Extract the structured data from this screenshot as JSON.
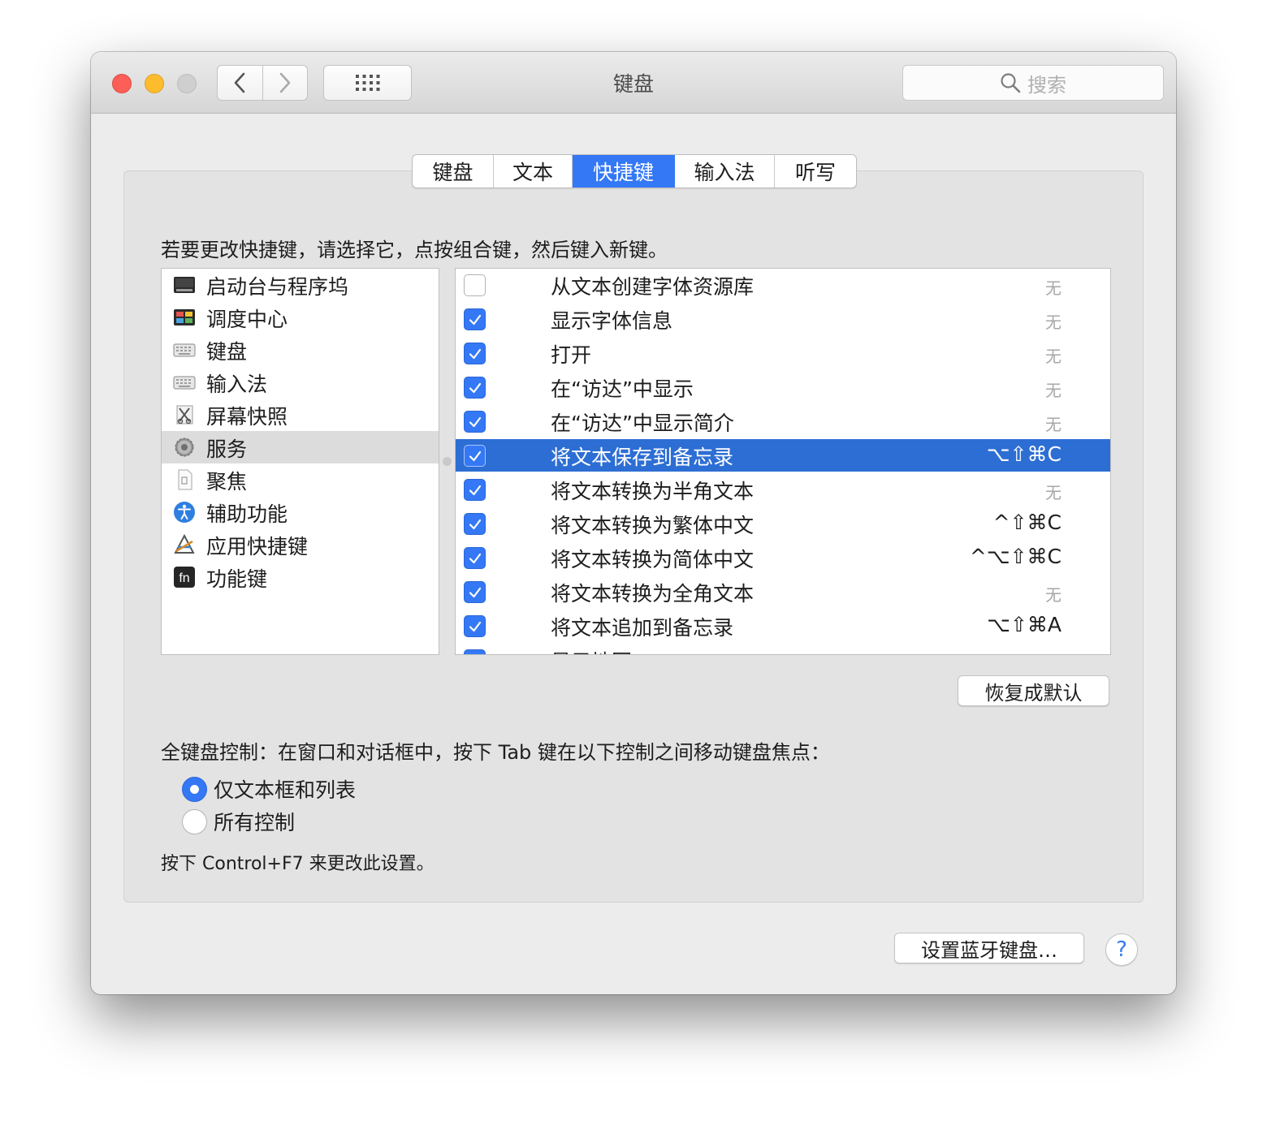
{
  "window": {
    "title": "键盘"
  },
  "search": {
    "placeholder": "搜索"
  },
  "tabs": [
    {
      "label": "键盘",
      "active": false
    },
    {
      "label": "文本",
      "active": false
    },
    {
      "label": "快捷键",
      "active": true
    },
    {
      "label": "输入法",
      "active": false
    },
    {
      "label": "听写",
      "active": false
    }
  ],
  "instruction": "若要更改快捷键，请选择它，点按组合键，然后键入新键。",
  "categories": [
    {
      "label": "启动台与程序坞",
      "icon": "launchpad-dock-icon"
    },
    {
      "label": "调度中心",
      "icon": "mission-control-icon"
    },
    {
      "label": "键盘",
      "icon": "keyboard-icon"
    },
    {
      "label": "输入法",
      "icon": "input-method-icon"
    },
    {
      "label": "屏幕快照",
      "icon": "screenshot-icon"
    },
    {
      "label": "服务",
      "icon": "services-gear-icon",
      "selected": true
    },
    {
      "label": "聚焦",
      "icon": "spotlight-icon"
    },
    {
      "label": "辅助功能",
      "icon": "accessibility-icon"
    },
    {
      "label": "应用快捷键",
      "icon": "app-shortcuts-icon"
    },
    {
      "label": "功能键",
      "icon": "fn-key-icon",
      "icon_text": "fn"
    }
  ],
  "shortcuts": [
    {
      "name": "从文本创建字体资源库",
      "key": "无",
      "checked": false
    },
    {
      "name": "显示字体信息",
      "key": "无",
      "checked": true
    },
    {
      "name": "打开",
      "key": "无",
      "checked": true
    },
    {
      "name": "在“访达”中显示",
      "key": "无",
      "checked": true
    },
    {
      "name": "在“访达”中显示简介",
      "key": "无",
      "checked": true
    },
    {
      "name": "将文本保存到备忘录",
      "key": "⌥⇧⌘C",
      "checked": true,
      "selected": true
    },
    {
      "name": "将文本转换为半角文本",
      "key": "无",
      "checked": true
    },
    {
      "name": "将文本转换为繁体中文",
      "key": "^⇧⌘C",
      "checked": true
    },
    {
      "name": "将文本转换为简体中文",
      "key": "^⌥⇧⌘C",
      "checked": true
    },
    {
      "name": "将文本转换为全角文本",
      "key": "无",
      "checked": true
    },
    {
      "name": "将文本追加到备忘录",
      "key": "⌥⇧⌘A",
      "checked": true
    },
    {
      "name": "显示地图",
      "key": "",
      "checked": true
    }
  ],
  "buttons": {
    "restore_defaults": "恢复成默认",
    "setup_bluetooth": "设置蓝牙键盘…",
    "help": "?"
  },
  "full_keyboard": {
    "description": "全键盘控制：在窗口和对话框中，按下 Tab 键在以下控制之间移动键盘焦点：",
    "options": [
      {
        "label": "仅文本框和列表",
        "selected": true
      },
      {
        "label": "所有控制",
        "selected": false
      }
    ],
    "note": "按下 Control+F7 来更改此设置。"
  },
  "colors": {
    "accent": "#3478f6",
    "selection": "#2d6ed4"
  }
}
